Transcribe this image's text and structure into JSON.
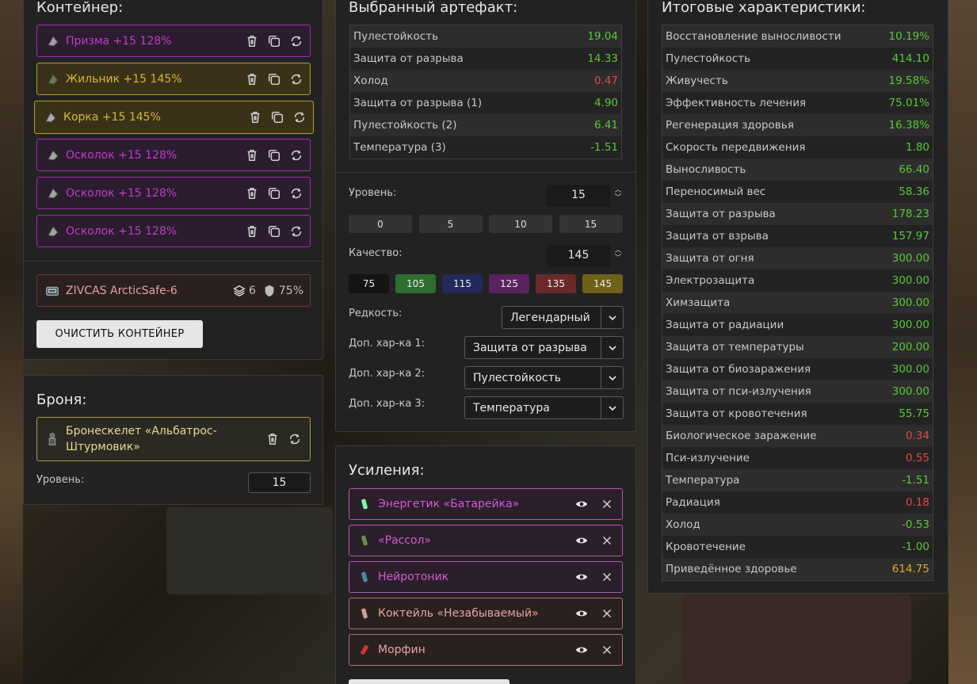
{
  "container": {
    "title": "Контейнер:",
    "slots": [
      {
        "label": "Призма +15 128%",
        "style": "purple"
      },
      {
        "label": "Жильник +15 145%",
        "style": "gold"
      },
      {
        "label": "Корка +15 145%",
        "style": "gold"
      },
      {
        "label": "Осколок +15 128%",
        "style": "purple"
      },
      {
        "label": "Осколок +15 128%",
        "style": "purple"
      },
      {
        "label": "Осколок +15 128%",
        "style": "purple"
      }
    ],
    "case": {
      "label": "ZIVCAS ArcticSafe-6",
      "slots": "6",
      "protection": "75%"
    },
    "clear_label": "ОЧИСТИТЬ КОНТЕЙНЕР"
  },
  "armor": {
    "title": "Броня:",
    "name": "Бронескелет «Альбатрос-Штурмовик»",
    "level_label": "Уровень:",
    "level": "15"
  },
  "artifact": {
    "title": "Выбранный артефакт:",
    "stats": [
      {
        "name": "Пулестойкость",
        "value": "19.04",
        "tone": "green"
      },
      {
        "name": "Защита от разрыва",
        "value": "14.33",
        "tone": "green"
      },
      {
        "name": "Холод",
        "value": "0.47",
        "tone": "red"
      },
      {
        "name": "Защита от разрыва (1)",
        "value": "4.90",
        "tone": "green"
      },
      {
        "name": "Пулестойкость (2)",
        "value": "6.41",
        "tone": "green"
      },
      {
        "name": "Температура (3)",
        "value": "-1.51",
        "tone": "green"
      }
    ],
    "level_label": "Уровень:",
    "level": "15",
    "level_quick": [
      "0",
      "5",
      "10",
      "15"
    ],
    "quality_label": "Качество:",
    "quality": "145",
    "quality_quick": [
      {
        "label": "75",
        "color": "#141414"
      },
      {
        "label": "105",
        "color": "#2f6e2f"
      },
      {
        "label": "115",
        "color": "#23285a"
      },
      {
        "label": "125",
        "color": "#5a2360"
      },
      {
        "label": "135",
        "color": "#6a2a2a"
      },
      {
        "label": "145",
        "color": "#6f6118"
      }
    ],
    "rarity_label": "Редкость:",
    "rarity": "Легендарный",
    "extra1_label": "Доп. хар-ка 1:",
    "extra1": "Защита от разрыва",
    "extra2_label": "Доп. хар-ка 2:",
    "extra2": "Пулестойкость",
    "extra3_label": "Доп. хар-ка 3:",
    "extra3": "Температура"
  },
  "boosts": {
    "title": "Усиления:",
    "items": [
      {
        "label": "Энергетик «Батарейка»",
        "style": "purple"
      },
      {
        "label": "«Рассол»",
        "style": "purple"
      },
      {
        "label": "Нейротоник",
        "style": "purple"
      },
      {
        "label": "Коктейль «Незабываемый»",
        "style": "red"
      },
      {
        "label": "Морфин",
        "style": "red"
      }
    ]
  },
  "totals": {
    "title": "Итоговые характеристики:",
    "stats": [
      {
        "name": "Восстановление выносливости",
        "value": "10.19%",
        "tone": "green"
      },
      {
        "name": "Пулестойкость",
        "value": "414.10",
        "tone": "green"
      },
      {
        "name": "Живучесть",
        "value": "19.58%",
        "tone": "green"
      },
      {
        "name": "Эффективность лечения",
        "value": "75.01%",
        "tone": "green"
      },
      {
        "name": "Регенерация здоровья",
        "value": "16.38%",
        "tone": "green"
      },
      {
        "name": "Скорость передвижения",
        "value": "1.80",
        "tone": "green"
      },
      {
        "name": "Выносливость",
        "value": "66.40",
        "tone": "green"
      },
      {
        "name": "Переносимый вес",
        "value": "58.36",
        "tone": "green"
      },
      {
        "name": "Защита от разрыва",
        "value": "178.23",
        "tone": "green"
      },
      {
        "name": "Защита от взрыва",
        "value": "157.97",
        "tone": "green"
      },
      {
        "name": "Защита от огня",
        "value": "300.00",
        "tone": "green"
      },
      {
        "name": "Электрозащита",
        "value": "300.00",
        "tone": "green"
      },
      {
        "name": "Химзащита",
        "value": "300.00",
        "tone": "green"
      },
      {
        "name": "Защита от радиации",
        "value": "300.00",
        "tone": "green"
      },
      {
        "name": "Защита от температуры",
        "value": "200.00",
        "tone": "green"
      },
      {
        "name": "Защита от биозаражения",
        "value": "300.00",
        "tone": "green"
      },
      {
        "name": "Защита от пси-излучения",
        "value": "300.00",
        "tone": "green"
      },
      {
        "name": "Защита от кровотечения",
        "value": "55.75",
        "tone": "green"
      },
      {
        "name": "Биологическое заражение",
        "value": "0.34",
        "tone": "red"
      },
      {
        "name": "Пси-излучение",
        "value": "0.55",
        "tone": "red"
      },
      {
        "name": "Температура",
        "value": "-1.51",
        "tone": "green"
      },
      {
        "name": "Радиация",
        "value": "0.18",
        "tone": "red"
      },
      {
        "name": "Холод",
        "value": "-0.53",
        "tone": "green"
      },
      {
        "name": "Кровотечение",
        "value": "-1.00",
        "tone": "green"
      },
      {
        "name": "Приведённое здоровье",
        "value": "614.75",
        "tone": "gold"
      }
    ]
  }
}
